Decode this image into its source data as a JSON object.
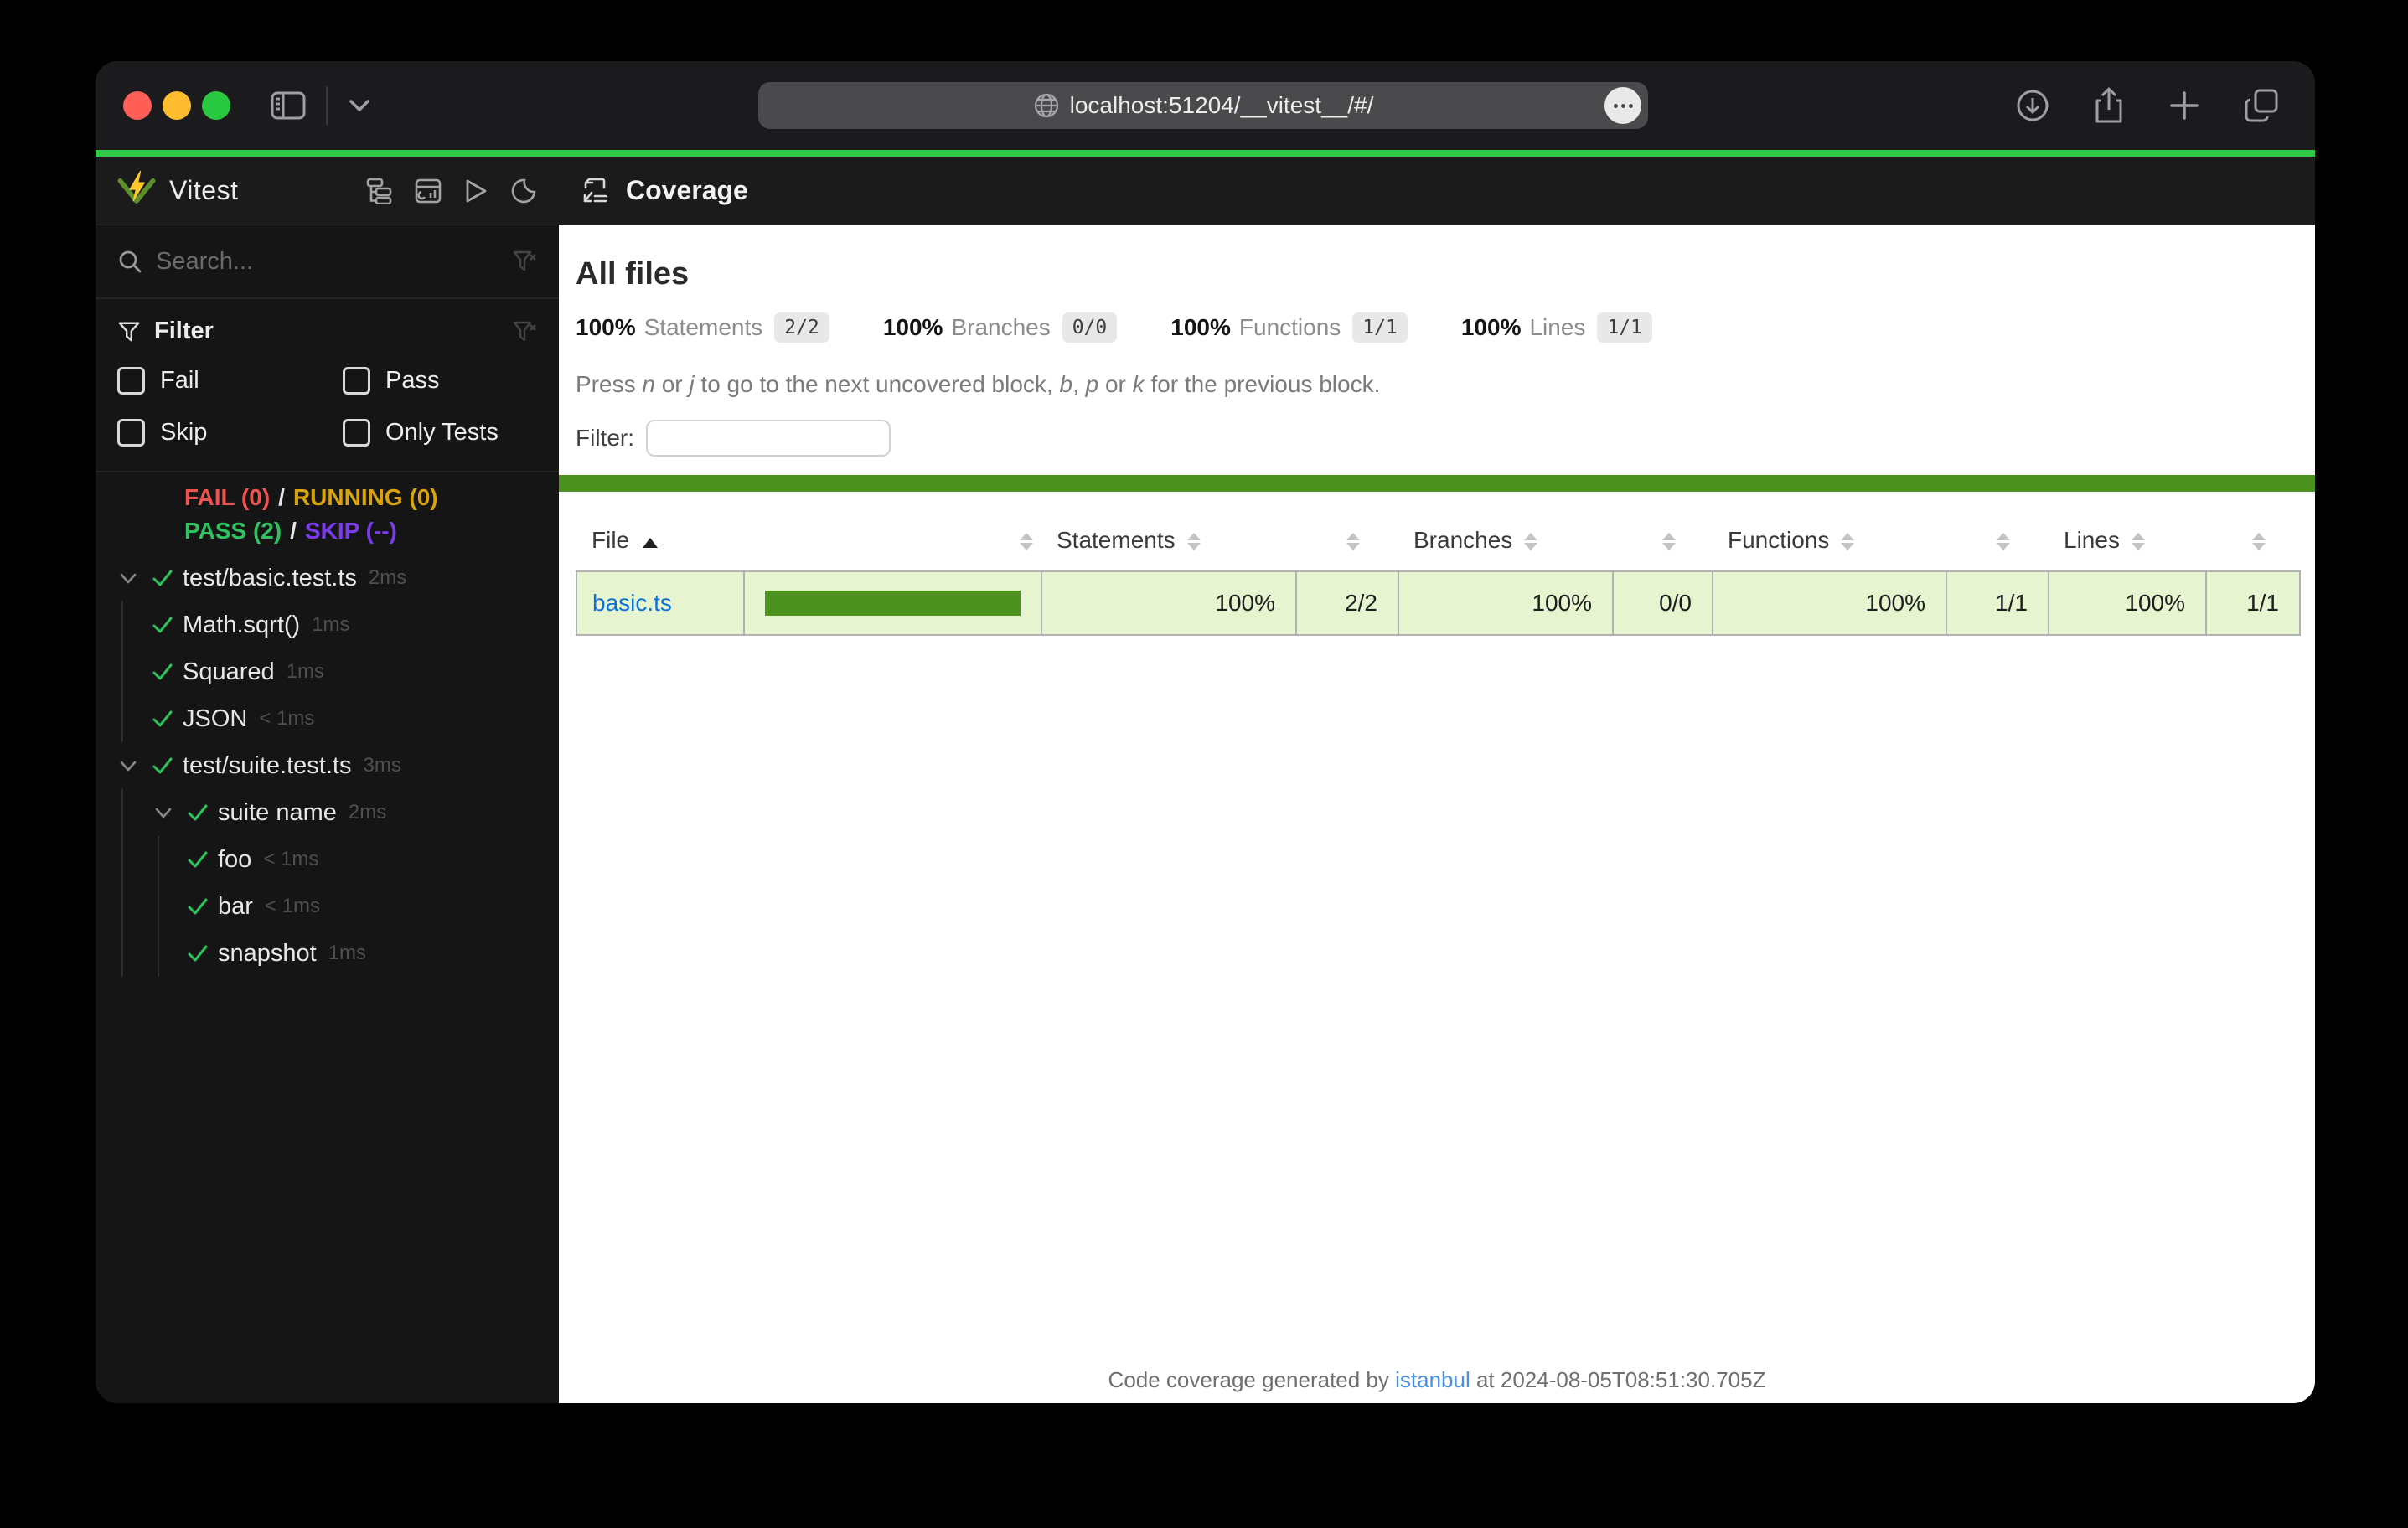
{
  "browser": {
    "url": "localhost:51204/__vitest__/#/"
  },
  "sidebar": {
    "app_name": "Vitest",
    "search_placeholder": "Search...",
    "filter": {
      "title": "Filter",
      "options": [
        "Fail",
        "Pass",
        "Skip",
        "Only Tests"
      ]
    },
    "status": {
      "fail": "FAIL (0)",
      "running": "RUNNING (0)",
      "pass": "PASS (2)",
      "skip": "SKIP (--)",
      "separator": "/"
    },
    "tree": [
      {
        "label": "test/basic.test.ts",
        "time": "2ms",
        "row": "file"
      },
      {
        "label": "Math.sqrt()",
        "time": "1ms",
        "row": "test1"
      },
      {
        "label": "Squared",
        "time": "1ms",
        "row": "test1"
      },
      {
        "label": "JSON",
        "time": "< 1ms",
        "row": "test1"
      },
      {
        "label": "test/suite.test.ts",
        "time": "3ms",
        "row": "file"
      },
      {
        "label": "suite name",
        "time": "2ms",
        "row": "suite"
      },
      {
        "label": "foo",
        "time": "< 1ms",
        "row": "test2"
      },
      {
        "label": "bar",
        "time": "< 1ms",
        "row": "test2"
      },
      {
        "label": "snapshot",
        "time": "1ms",
        "row": "test2"
      }
    ]
  },
  "main": {
    "header_title": "Coverage",
    "page_title": "All files",
    "stats": [
      {
        "pct": "100%",
        "label": "Statements",
        "fraction": "2/2"
      },
      {
        "pct": "100%",
        "label": "Branches",
        "fraction": "0/0"
      },
      {
        "pct": "100%",
        "label": "Functions",
        "fraction": "1/1"
      },
      {
        "pct": "100%",
        "label": "Lines",
        "fraction": "1/1"
      }
    ],
    "hint_parts": [
      {
        "text": "Press "
      },
      {
        "text": "n",
        "key": true
      },
      {
        "text": " or "
      },
      {
        "text": "j",
        "key": true
      },
      {
        "text": " to go to the next uncovered block, "
      },
      {
        "text": "b",
        "key": true
      },
      {
        "text": ", "
      },
      {
        "text": "p",
        "key": true
      },
      {
        "text": " or "
      },
      {
        "text": "k",
        "key": true
      },
      {
        "text": " for the previous block."
      }
    ],
    "filter_label": "Filter:",
    "filter_value": "",
    "table": {
      "column_labels": [
        "File",
        "Statements",
        "Branches",
        "Functions",
        "Lines"
      ],
      "row": {
        "file": "basic.ts",
        "bar_pct": 100,
        "statements_pct": "100%",
        "statements_frac": "2/2",
        "branches_pct": "100%",
        "branches_frac": "0/0",
        "functions_pct": "100%",
        "functions_frac": "1/1",
        "lines_pct": "100%",
        "lines_frac": "1/1"
      }
    },
    "footer": {
      "prefix": "Code coverage generated by ",
      "link_text": "istanbul",
      "suffix": " at 2024-08-05T08:51:30.705Z"
    }
  },
  "colors": {
    "accent_green": "#2fc945",
    "coverage_green": "#4d9221",
    "coverage_cell_bg": "#e6f5d0",
    "pass": "#2fc35f",
    "fail": "#ef5350",
    "running": "#d9a409",
    "skip": "#7c3aed",
    "link_blue": "#0d6fd8",
    "footer_link": "#4a90e2"
  }
}
